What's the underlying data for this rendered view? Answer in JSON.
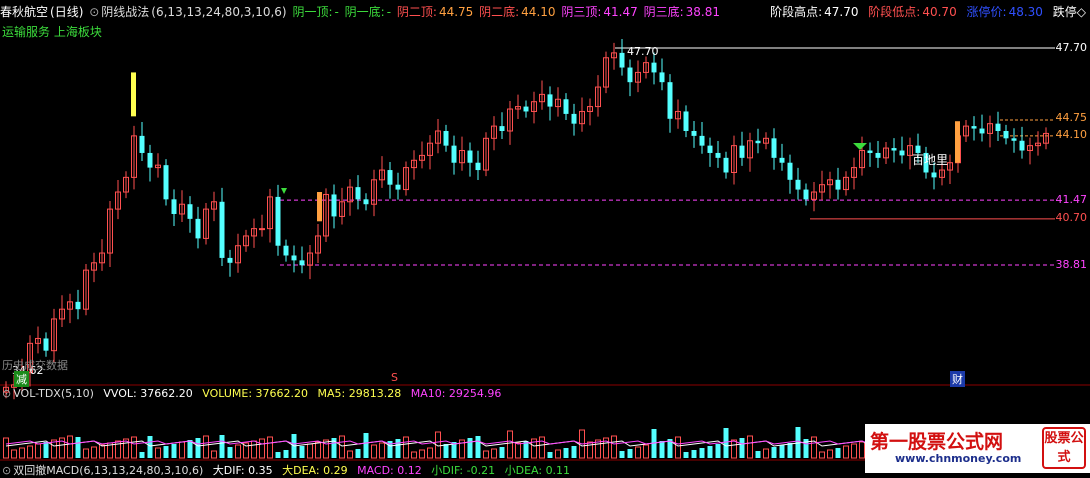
{
  "header": {
    "stock_name": "春秋航空",
    "period": "(日线)",
    "indicator_name": "阴线战法",
    "indicator_params": "(6,13,13,24,80,3,10,6)",
    "y1_top_label": "阴一顶:",
    "y1_top_value": "-",
    "y1_bot_label": "阴一底:",
    "y1_bot_value": "-",
    "y2_top_label": "阴二顶:",
    "y2_top_value": "44.75",
    "y2_bot_label": "阴二底:",
    "y2_bot_value": "44.10",
    "y3_top_label": "阴三顶:",
    "y3_top_value": "41.47",
    "y3_bot_label": "阴三底:",
    "y3_bot_value": "38.81"
  },
  "right_header": {
    "high_label": "阶段高点:",
    "high_value": "47.70",
    "low_label": "阶段低点:",
    "low_value": "40.70",
    "limit_label": "涨停价:",
    "limit_value": "48.30",
    "limit_down_label": "跌停◇"
  },
  "sector": "运输服务 上海板块",
  "price_ticks": [
    "47.70",
    "44.75",
    "44.10",
    "41.47",
    "40.70",
    "38.81"
  ],
  "annotations": {
    "peak": "47.70",
    "low": "34.62",
    "mark_s": "S",
    "mark_cai": "财",
    "mark_jian": "减",
    "mark_baidi": "百地里",
    "history_note": "历史成交数据"
  },
  "volume": {
    "name": "VOL-TDX(5,10)",
    "vvol": "VVOL: 37662.20",
    "volume": "VOLUME: 37662.20",
    "ma5": "MA5: 29813.28",
    "ma10": "MA10: 29254.96"
  },
  "macd": {
    "name": "双回撤MACD(6,13,13,24,80,3,10,6)",
    "dif": "大DIF: 0.35",
    "dea": "大DEA: 0.29",
    "macd": "MACD: 0.12",
    "small_dif": "小DIF: -0.21",
    "small_dea": "小DEA: 0.11"
  },
  "watermark": {
    "title": "第一股票公式网",
    "url": "www.chnmoney.com",
    "logo": "股票公式"
  },
  "colors": {
    "up": "#ff5050",
    "down": "#54ffff",
    "magenta": "#ff44ff",
    "orange": "#ffa040",
    "yellow": "#ffff50",
    "white": "#ffffff"
  }
}
